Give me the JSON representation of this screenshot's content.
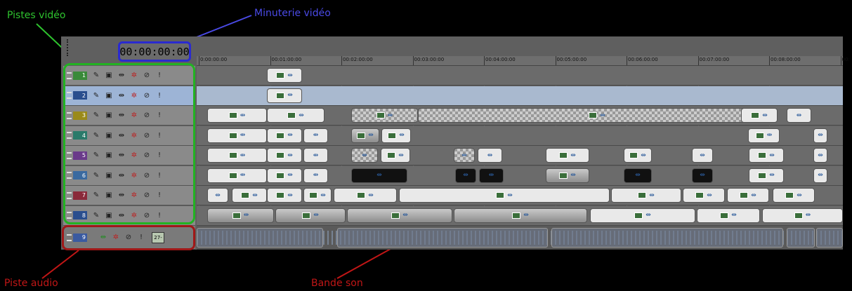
{
  "annotations": {
    "video_tracks": "Pistes vidéo",
    "video_timer": "Minuterie vidéo",
    "audio_track": "Piste audio",
    "soundtrack": "Bande son"
  },
  "timecode": "00:00:00:00",
  "ruler": {
    "ticks": [
      "0:00:00:00",
      "00:01:00:00",
      "00:02:00:00",
      "00:03:00:00",
      "00:04:00:00",
      "00:05:00:00",
      "00:06:00:00",
      "00:07:00:00",
      "00:08:00:00",
      "00:"
    ]
  },
  "video_tracks": [
    {
      "number": "1",
      "color": "#3a8a3a"
    },
    {
      "number": "2",
      "color": "#2a4e8e",
      "selected": true
    },
    {
      "number": "3",
      "color": "#9a8a1a"
    },
    {
      "number": "4",
      "color": "#2a7a6a"
    },
    {
      "number": "5",
      "color": "#6a3a8a"
    },
    {
      "number": "6",
      "color": "#3a6aa0"
    },
    {
      "number": "7",
      "color": "#8a2a3a"
    },
    {
      "number": "8",
      "color": "#2a4e8e"
    }
  ],
  "audio_track": {
    "number": "9",
    "meter": "27-",
    "color": "#3a5aa0"
  },
  "icons": {
    "edit": "edit-icon",
    "overlay": "overlay-icon",
    "motion": "motion-icon",
    "fx": "gear-fx-icon",
    "mute": "mute-icon",
    "solo": "solo-icon"
  },
  "colors": {
    "green": "#22b322",
    "blue": "#2a2ad0",
    "red": "#a01818"
  }
}
